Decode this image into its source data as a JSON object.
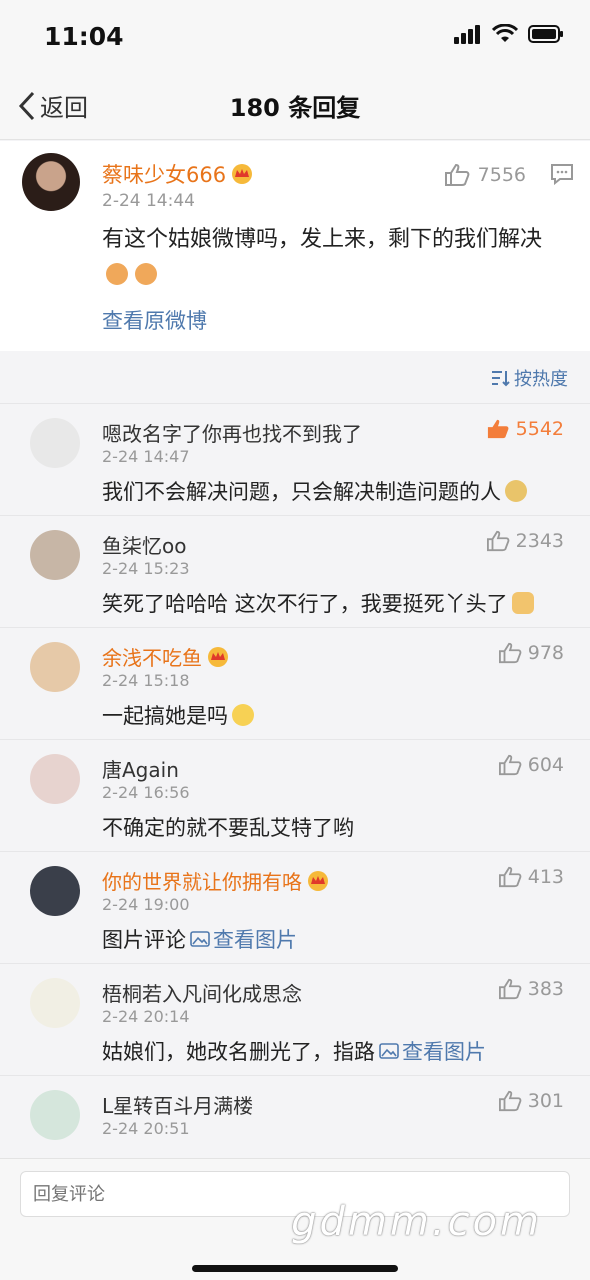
{
  "status_bar": {
    "time": "11:04"
  },
  "nav": {
    "back_label": "返回",
    "title": "180 条回复"
  },
  "original": {
    "name": "蔡味少女666",
    "time": "2-24 14:44",
    "likes": "7556",
    "text": "有这个姑娘微博吗，发上来，剩下的我们解决",
    "view_original": "查看原微博"
  },
  "sort": {
    "label": "按热度"
  },
  "replies": [
    {
      "name": "嗯改名字了你再也找不到我了",
      "time": "2-24 14:47",
      "likes": "5542",
      "text": "我们不会解决问题，只会解决制造问题的人"
    },
    {
      "name": "鱼柒忆oo",
      "time": "2-24 15:23",
      "likes": "2343",
      "text": "笑死了哈哈哈 这次不行了，我要挺死丫头了"
    },
    {
      "name": "余浅不吃鱼",
      "time": "2-24 15:18",
      "likes": "978",
      "text": "一起搞她是吗"
    },
    {
      "name": "唐Again",
      "time": "2-24 16:56",
      "likes": "604",
      "text": "不确定的就不要乱艾特了哟"
    },
    {
      "name": "你的世界就让你拥有咯",
      "time": "2-24 19:00",
      "likes": "413",
      "text": "图片评论",
      "link": "查看图片"
    },
    {
      "name": "梧桐若入凡间化成思念",
      "time": "2-24 20:14",
      "likes": "383",
      "text": "姑娘们，她改名删光了，指路",
      "link": "查看图片"
    },
    {
      "name": "L星转百斗月满楼",
      "time": "2-24 20:51",
      "likes": "301"
    }
  ],
  "input": {
    "placeholder": "回复评论"
  },
  "watermark": "gdmm.com",
  "colors": {
    "vip_name": "#e8741a",
    "link": "#4f79ad",
    "hot_like": "#f37d3a"
  }
}
